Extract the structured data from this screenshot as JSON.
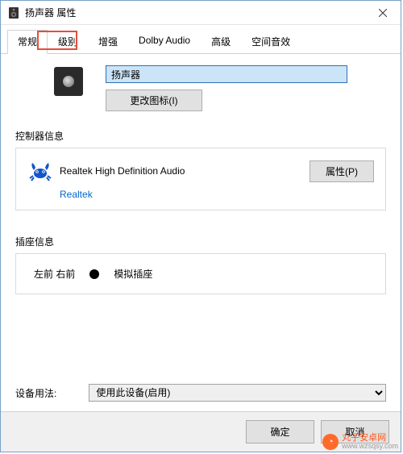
{
  "window": {
    "title": "扬声器 属性"
  },
  "tabs": {
    "items": [
      {
        "label": "常规"
      },
      {
        "label": "级别"
      },
      {
        "label": "增强"
      },
      {
        "label": "Dolby Audio"
      },
      {
        "label": "高级"
      },
      {
        "label": "空间音效"
      }
    ],
    "active_index": 0,
    "highlighted_index": 1
  },
  "general": {
    "device_name": "扬声器",
    "change_icon_label": "更改图标(I)"
  },
  "controller": {
    "group_label": "控制器信息",
    "name": "Realtek High Definition Audio",
    "vendor": "Realtek",
    "properties_label": "属性(P)"
  },
  "jack": {
    "group_label": "插座信息",
    "location": "左前 右前",
    "type": "模拟插座"
  },
  "usage": {
    "label": "设备用法:",
    "selected": "使用此设备(启用)"
  },
  "footer": {
    "ok": "确定",
    "cancel": "取消"
  },
  "watermark": {
    "name": "丸子安卓网",
    "url": "www.wzsqsy.com"
  }
}
